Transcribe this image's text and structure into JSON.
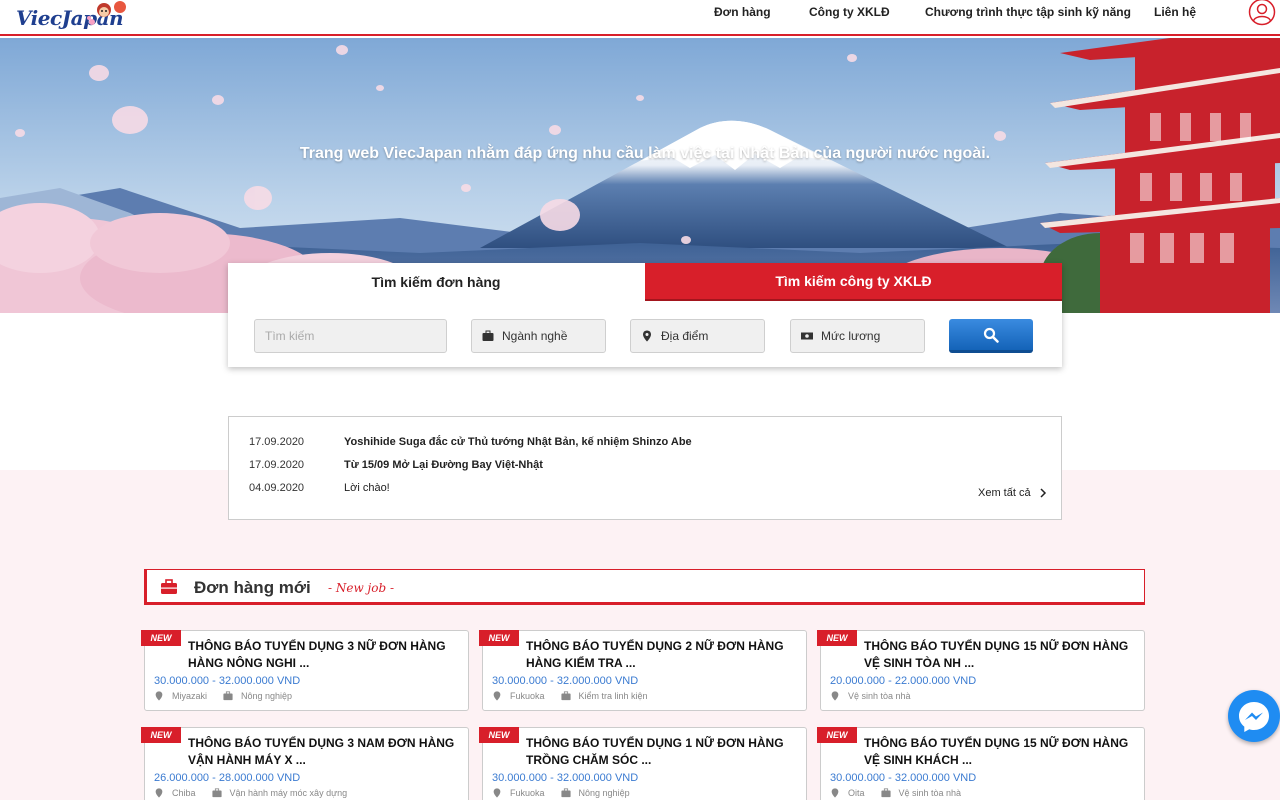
{
  "header": {
    "logo_text": "ViecJapan",
    "nav": [
      "Đơn hàng",
      "Công ty XKLĐ",
      "Chương trình thực tập sinh kỹ năng",
      "Liên hệ"
    ]
  },
  "hero": {
    "tagline": "Trang web ViecJapan nhằm đáp ứng nhu cầu làm việc tại Nhật Bản của người nước ngoài."
  },
  "search": {
    "tabs": [
      "Tìm kiếm đơn hàng",
      "Tìm kiếm công ty XKLĐ"
    ],
    "keyword_placeholder": "Tìm kiếm",
    "industry_label": "Ngành nghề",
    "location_label": "Địa điểm",
    "salary_label": "Mức lương"
  },
  "news": {
    "items": [
      {
        "date": "17.09.2020",
        "title": "Yoshihide Suga đắc cử Thủ tướng Nhật Bản, kế nhiệm Shinzo Abe"
      },
      {
        "date": "17.09.2020",
        "title": "Từ 15/09 Mở Lại Đường Bay Việt-Nhật"
      },
      {
        "date": "04.09.2020",
        "title": "Lời chào!"
      }
    ],
    "see_all": "Xem tất cả"
  },
  "section": {
    "title": "Đơn hàng mới",
    "subtitle": "- New job -"
  },
  "jobs": [
    {
      "badge": "NEW",
      "title": "THÔNG BÁO TUYỂN DỤNG 3 NỮ ĐƠN HÀNG HÀNG NÔNG NGHI ...",
      "salary": "30.000.000 - 32.000.000 VND",
      "location": "Miyazaki",
      "category": "Nông nghiệp"
    },
    {
      "badge": "NEW",
      "title": "THÔNG BÁO TUYỂN DỤNG 2 NỮ ĐƠN HÀNG HÀNG KIỂM TRA ...",
      "salary": "30.000.000 - 32.000.000 VND",
      "location": "Fukuoka",
      "category": "Kiểm tra linh kiện"
    },
    {
      "badge": "NEW",
      "title": "THÔNG BÁO TUYỂN DỤNG 15 NỮ ĐƠN HÀNG VỆ SINH TÒA NH ...",
      "salary": "20.000.000 - 22.000.000 VND",
      "location": "",
      "category": "Vệ sinh tòa nhà"
    },
    {
      "badge": "NEW",
      "title": "THÔNG BÁO TUYỂN DỤNG 3 NAM ĐƠN HÀNG VẬN HÀNH MÁY X ...",
      "salary": "26.000.000 - 28.000.000 VND",
      "location": "Chiba",
      "category": "Vận hành máy móc xây dựng"
    },
    {
      "badge": "NEW",
      "title": "THÔNG BÁO TUYỂN DỤNG 1 NỮ ĐƠN HÀNG TRỒNG CHĂM SÓC ...",
      "salary": "30.000.000 - 32.000.000 VND",
      "location": "Fukuoka",
      "category": "Nông nghiệp"
    },
    {
      "badge": "NEW",
      "title": "THÔNG BÁO TUYỂN DỤNG 15 NỮ ĐƠN HÀNG VỆ SINH KHÁCH ...",
      "salary": "30.000.000 - 32.000.000 VND",
      "location": "Oita",
      "category": "Vệ sinh tòa nhà"
    }
  ],
  "colors": {
    "brand_red": "#d81f2a",
    "salary_blue": "#3b7bd1",
    "search_button": "#1f6fc9",
    "messenger": "#1f8cf2"
  },
  "icons": {
    "user": "user-icon",
    "search": "search-icon",
    "briefcase": "briefcase-icon",
    "location": "map-pin-icon",
    "salary": "money-icon",
    "see_all": "chevron-right-icon",
    "messenger": "messenger-icon"
  }
}
